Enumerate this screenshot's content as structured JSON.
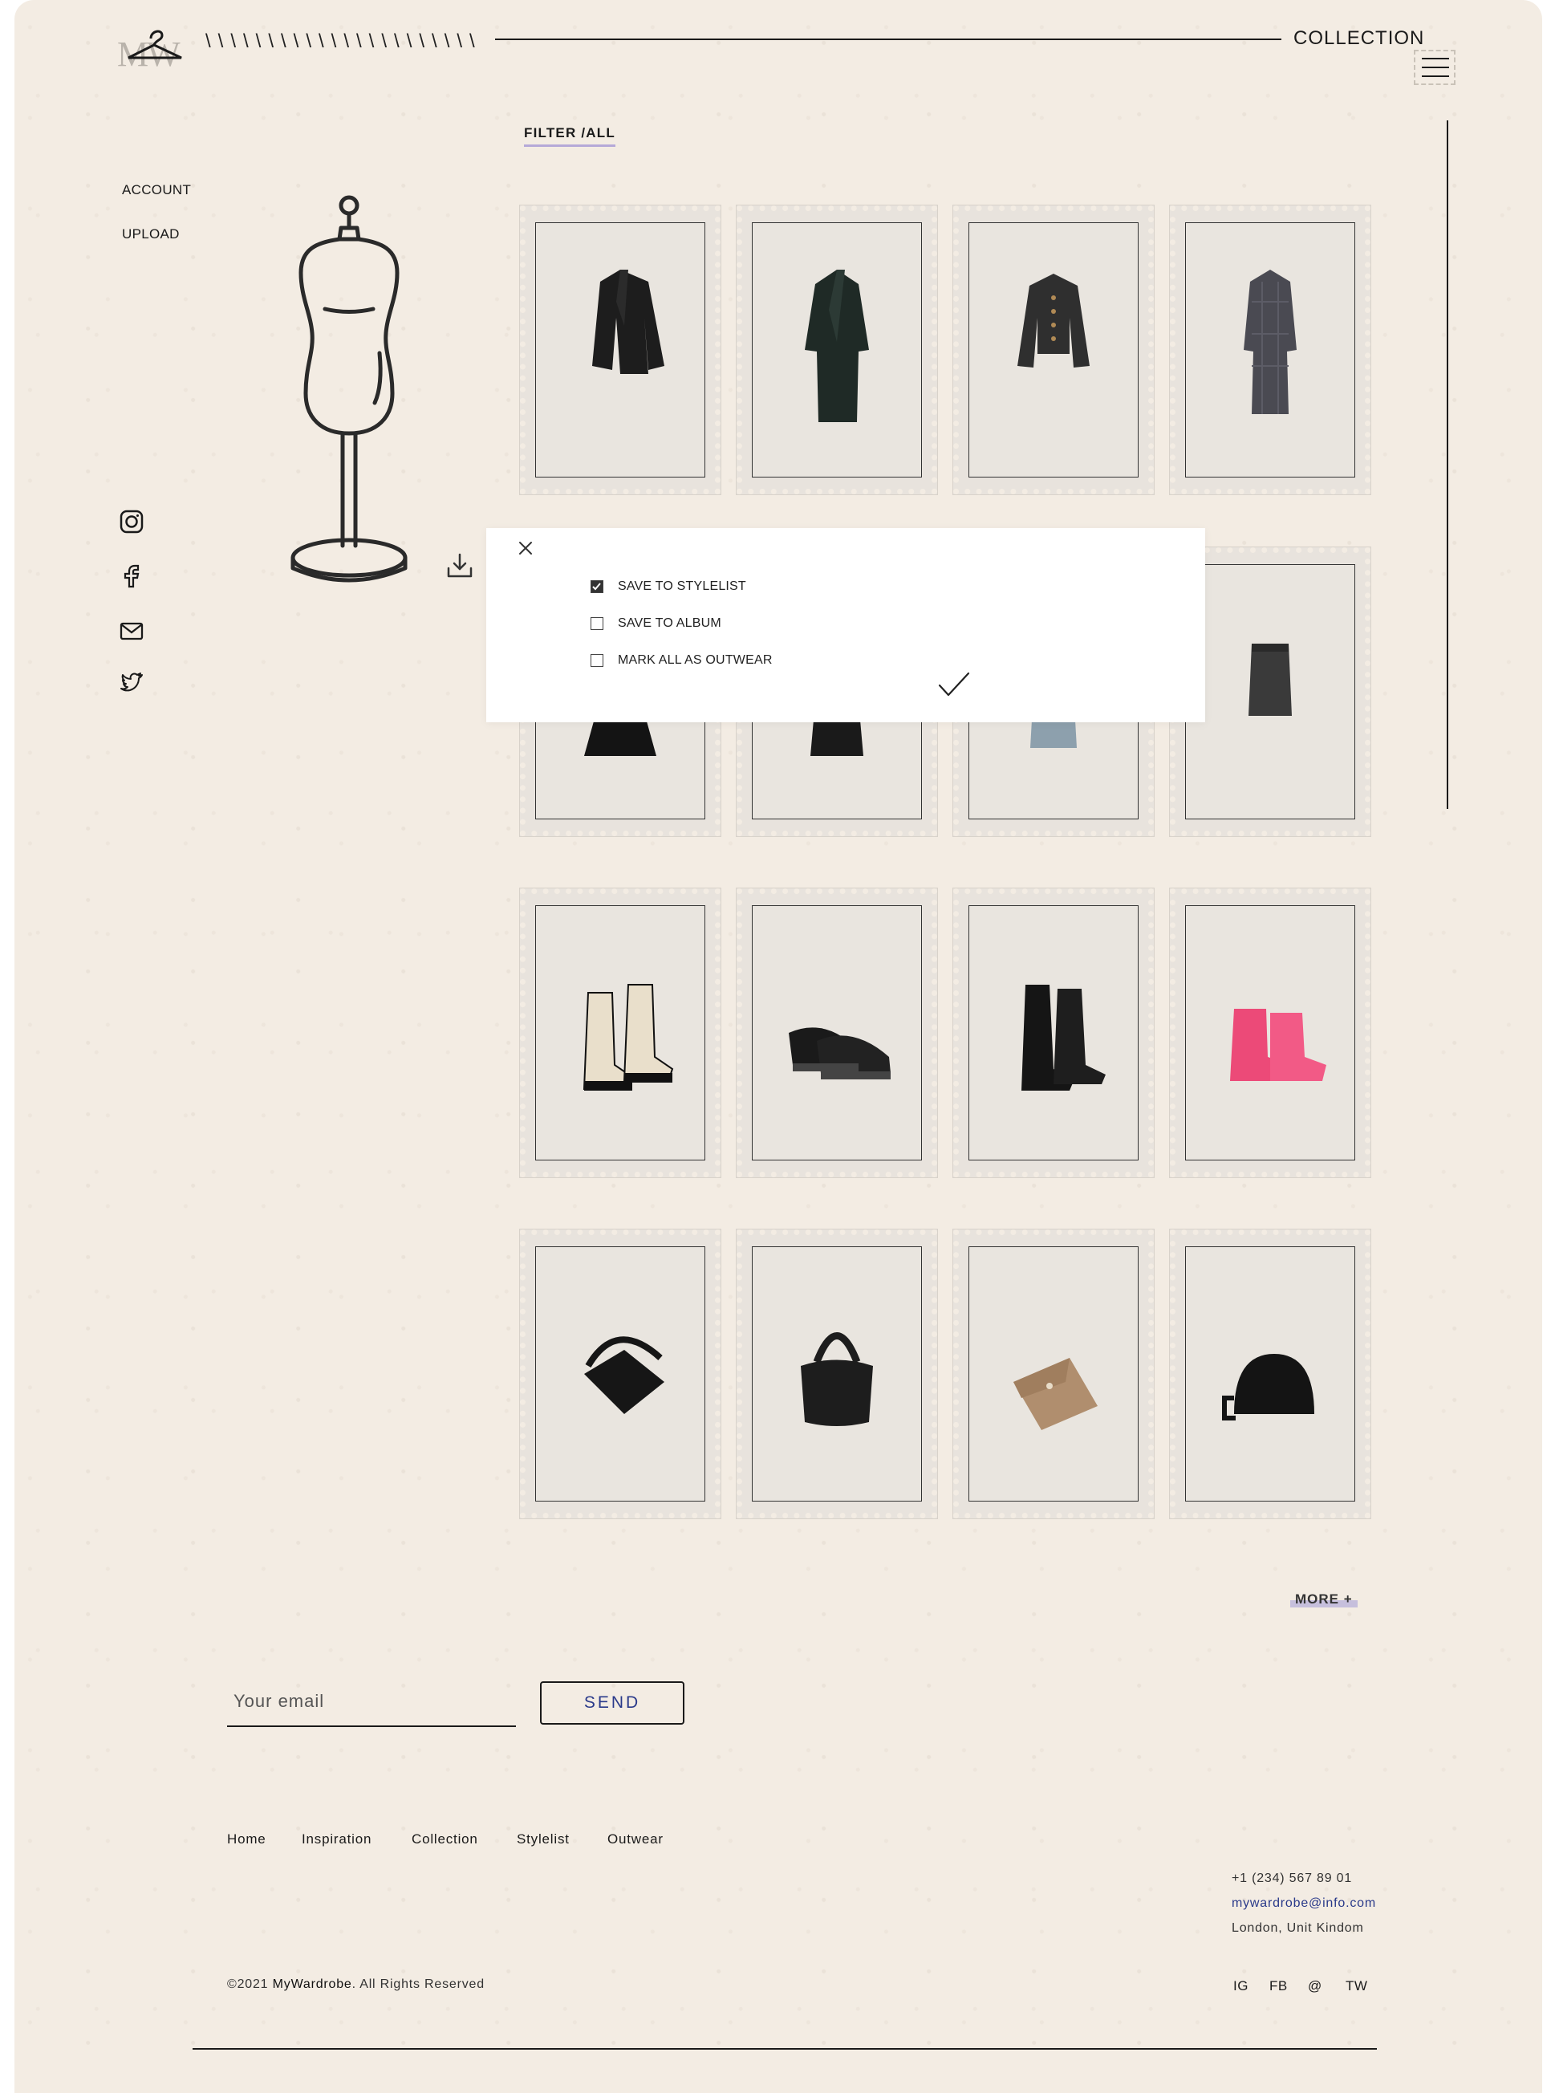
{
  "header": {
    "logo_letters": "MW",
    "slashes": "\\\\\\\\\\\\\\\\\\\\\\\\\\\\\\\\\\\\\\\\\\\\",
    "title": "COLLECTION"
  },
  "nav": {
    "account": "ACCOUNT",
    "upload": "UPLOAD"
  },
  "social_icons": [
    "instagram-icon",
    "facebook-icon",
    "mail-icon",
    "twitter-icon"
  ],
  "filter": "FILTER /ALL",
  "grid": {
    "rows": [
      [
        "blazer",
        "long-coat",
        "tweed-jacket",
        "check-coat"
      ],
      [
        "dress",
        "leather-skirt",
        "denim-skirt",
        "tweed-skirt"
      ],
      [
        "chelsea-boots",
        "derby-shoes",
        "combat-boots",
        "rain-boots"
      ],
      [
        "shoulder-bag",
        "hobo-bag",
        "card-holder",
        "crossbody-bag"
      ]
    ]
  },
  "modal": {
    "options": [
      {
        "label": "SAVE TO STYLELIST",
        "checked": true
      },
      {
        "label": "SAVE TO ALBUM",
        "checked": false
      },
      {
        "label": "MARK ALL AS OUTWEAR",
        "checked": false
      }
    ]
  },
  "more_label": "MORE +",
  "subscribe": {
    "placeholder": "Your email",
    "button": "SEND"
  },
  "footer": {
    "links": [
      "Home",
      "Inspiration",
      "Collection",
      "Stylelist",
      "Outwear"
    ],
    "phone": "+1 (234) 567 89 01",
    "email": "mywardrobe@info.com",
    "address": "London, Unit Kindom",
    "copyright_prefix": "©2021 ",
    "brand": "MyWardrobe",
    "copyright_suffix": ". All Rights Reserved",
    "social": [
      "IG",
      "FB",
      "@",
      "TW"
    ]
  }
}
